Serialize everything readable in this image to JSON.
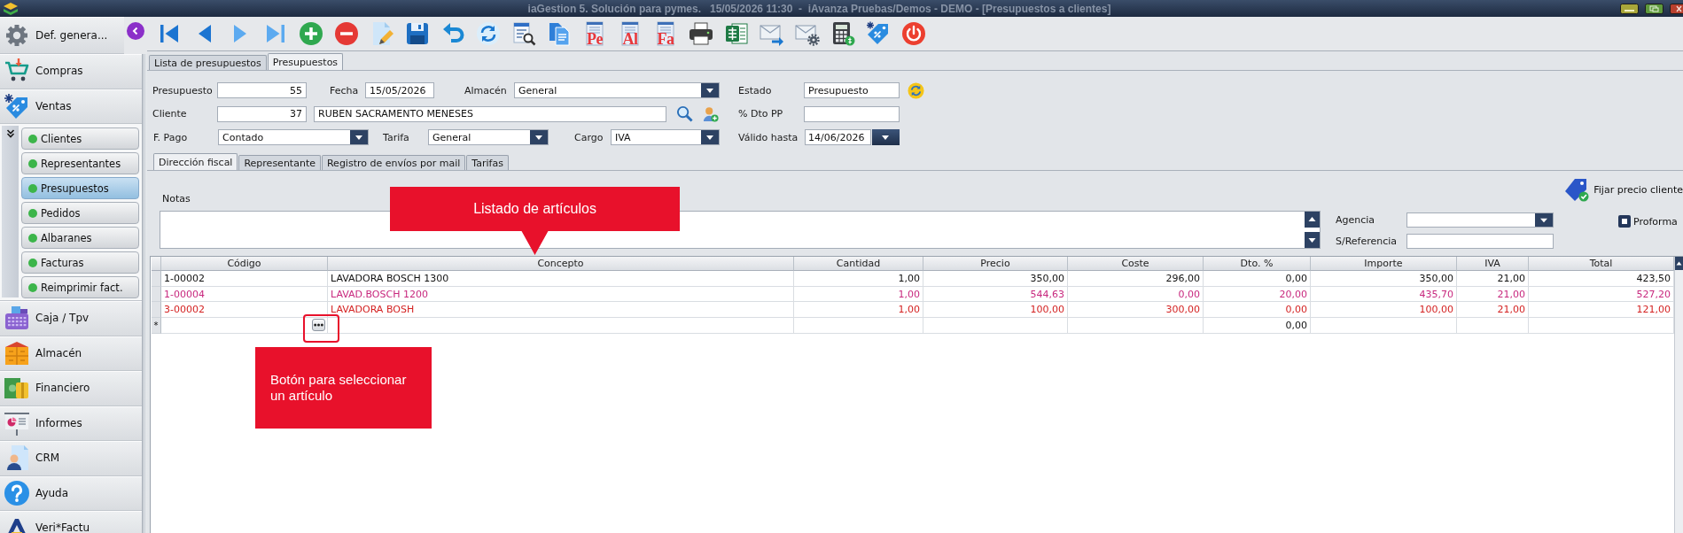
{
  "window": {
    "title": "iaGestion 5. Solución para pymes.   15/05/2026 11:30  -  iAvanza Pruebas/Demos - DEMO - [Presupuestos a clientes]"
  },
  "sidebar": {
    "items": [
      {
        "kind": "settings",
        "label": "Def. genera..."
      },
      {
        "kind": "cart",
        "label": "Compras"
      },
      {
        "kind": "tag",
        "label": "Ventas",
        "children": [
          {
            "label": "Clientes",
            "selected": false
          },
          {
            "label": "Representantes",
            "selected": false
          },
          {
            "label": "Presupuestos",
            "selected": true
          },
          {
            "label": "Pedidos",
            "selected": false
          },
          {
            "label": "Albaranes",
            "selected": false
          },
          {
            "label": "Facturas",
            "selected": false
          },
          {
            "label": "Reimprimir fact.",
            "selected": false
          }
        ]
      },
      {
        "kind": "register",
        "label": "Caja / Tpv"
      },
      {
        "kind": "boxes",
        "label": "Almacén"
      },
      {
        "kind": "money",
        "label": "Financiero"
      },
      {
        "kind": "chart",
        "label": "Informes"
      },
      {
        "kind": "contact",
        "label": "CRM"
      },
      {
        "kind": "help",
        "label": "Ayuda"
      },
      {
        "kind": "logo",
        "label": "Veri*Factu"
      }
    ]
  },
  "toolbar": [
    {
      "kind": "first"
    },
    {
      "kind": "previous"
    },
    {
      "kind": "next"
    },
    {
      "kind": "last"
    },
    {
      "kind": "add"
    },
    {
      "kind": "delete"
    },
    {
      "kind": "edit"
    },
    {
      "kind": "save"
    },
    {
      "kind": "undo"
    },
    {
      "kind": "refresh"
    },
    {
      "kind": "search"
    },
    {
      "kind": "copy"
    },
    {
      "kind": "report",
      "label": "Pe"
    },
    {
      "kind": "report",
      "label": "Al"
    },
    {
      "kind": "report",
      "label": "Fa"
    },
    {
      "kind": "print"
    },
    {
      "kind": "spreadsheet"
    },
    {
      "kind": "send-mail"
    },
    {
      "kind": "mail-settings"
    },
    {
      "kind": "calculator"
    },
    {
      "kind": "price-tag"
    },
    {
      "kind": "power"
    }
  ],
  "tabs": [
    {
      "label": "Lista de presupuestos",
      "selected": false
    },
    {
      "label": "Presupuestos",
      "selected": true
    }
  ],
  "form": {
    "number": {
      "label": "Presupuesto",
      "value": "55"
    },
    "date": {
      "label": "Fecha",
      "value": "15/05/2026"
    },
    "warehouse": {
      "label": "Almacén",
      "value": "General"
    },
    "status": {
      "label": "Estado",
      "value": "Presupuesto"
    },
    "client": {
      "label": "Cliente",
      "value": "37",
      "name": "RUBEN SACRAMENTO MENESES"
    },
    "discount": {
      "label": "% Dto PP"
    },
    "payment": {
      "label": "F. Pago",
      "value": "Contado"
    },
    "rate": {
      "label": "Tarifa",
      "value": "General"
    },
    "charge": {
      "label": "Cargo",
      "value": "IVA"
    },
    "valid_until": {
      "label": "Válido hasta",
      "value": "14/06/2026"
    }
  },
  "detail_tabs": [
    {
      "label": "Dirección fiscal",
      "selected": true
    },
    {
      "label": "Representante",
      "selected": false
    },
    {
      "label": "Registro de envíos por mail",
      "selected": false
    },
    {
      "label": "Tarifas",
      "selected": false
    }
  ],
  "details": {
    "notes": {
      "label": "Notas"
    },
    "fix_price": {
      "label": "Fijar precio cliente"
    },
    "agency": {
      "label": "Agencia"
    },
    "reference": {
      "label": "S/Referencia"
    },
    "proforma": {
      "label": "Proforma",
      "checked": false
    }
  },
  "table": {
    "columns": [
      "Código",
      "Concepto",
      "Cantidad",
      "Precio",
      "Coste",
      "Dto. %",
      "Importe",
      "IVA",
      "Total"
    ],
    "rows": [
      {
        "color": "#111111",
        "cells": [
          "1-00002",
          "LAVADORA BOSCH 1300",
          "1,00",
          "350,00",
          "296,00",
          "0,00",
          "350,00",
          "21,00",
          "423,50"
        ]
      },
      {
        "color": "#c8287e",
        "cells": [
          "1-00004",
          "LAVAD.BOSCH 1200",
          "1,00",
          "544,63",
          "0,00",
          "20,00",
          "435,70",
          "21,00",
          "527,20"
        ]
      },
      {
        "color": "#d42222",
        "cells": [
          "3-00002",
          "LAVADORA BOSH",
          "1,00",
          "100,00",
          "300,00",
          "0,00",
          "100,00",
          "21,00",
          "121,00"
        ]
      }
    ],
    "new_row": {
      "marker": "*",
      "cells": [
        null,
        null,
        null,
        null,
        null,
        "0,00",
        null,
        null,
        null
      ],
      "button_highlighted": true
    }
  },
  "callouts": [
    {
      "kind": "pointer",
      "text": "Listado de artículos"
    },
    {
      "kind": "plain",
      "text": "Botón para seleccionar un artículo"
    }
  ]
}
